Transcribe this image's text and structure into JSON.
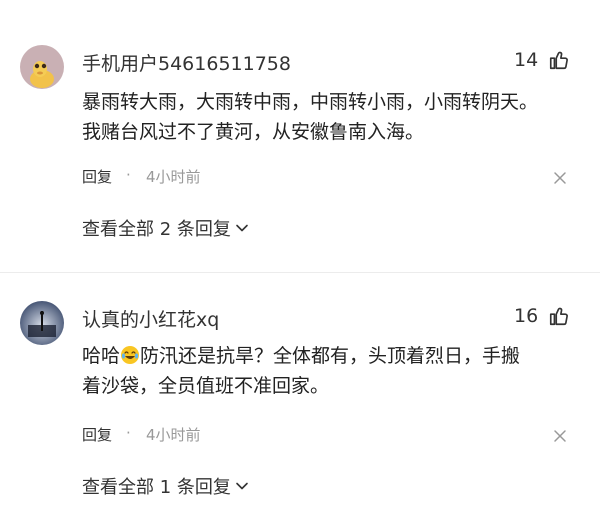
{
  "comments": [
    {
      "username": "手机用户54616511758",
      "likes": "14",
      "content_lines": [
        "暴雨转大雨，大雨转中雨，中雨转小雨，小雨转阴天。",
        "我赌台风过不了黄河，从安徽鲁南入海。"
      ],
      "reply_label": "回复",
      "separator": "·",
      "time": "4小时前",
      "view_all": "查看全部 2 条回复"
    },
    {
      "username": "认真的小红花xq",
      "likes": "16",
      "content_before_emoji": "哈哈",
      "emoji_icon": "laughing-crying-emoji",
      "content_after_emoji": "防汛还是抗旱？全体都有，头顶着烈日，手搬",
      "content_line2": "着沙袋，全员值班不准回家。",
      "reply_label": "回复",
      "separator": "·",
      "time": "4小时前",
      "view_all": "查看全部 1 条回复"
    }
  ],
  "colors": {
    "text": "#222222",
    "meta": "#999999",
    "divider": "#ececec"
  }
}
